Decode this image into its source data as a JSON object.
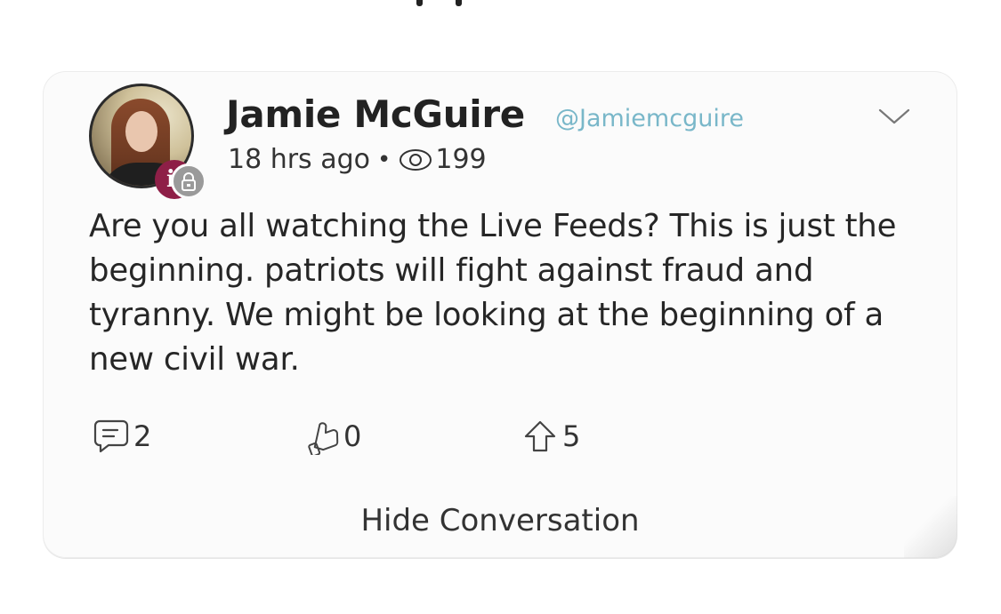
{
  "post": {
    "author_name": "Jamie McGuire",
    "author_handle": "@Jamiemcguire",
    "time_ago": "18 hrs ago",
    "separator": "•",
    "view_count": "199",
    "body": "Are you all watching the Live Feeds? This is just the beginning. patriots will fight against fraud and tyranny. We might be looking at the beginning of a new civil war.",
    "avatar_badge_letter": "i"
  },
  "actions": {
    "comments_count": "2",
    "likes_count": "0",
    "upvotes_count": "5"
  },
  "footer": {
    "hide_conversation_label": "Hide Conversation"
  },
  "icons": {
    "menu": "chevron-down-icon",
    "views": "eye-icon",
    "comment": "comment-icon",
    "like": "thumb-icon",
    "upvote": "arrow-up-icon",
    "lock": "lock-icon"
  },
  "colors": {
    "handle": "#79b7c9",
    "badge": "#8e1f47",
    "text": "#262626",
    "card_background": "#fbfbfb"
  }
}
